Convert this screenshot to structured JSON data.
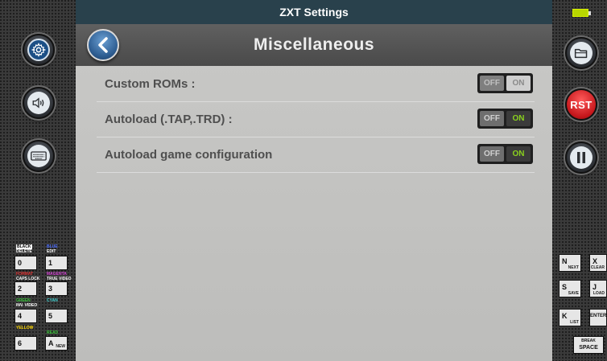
{
  "window": {
    "title": "ZXT Settings"
  },
  "header": {
    "title": "Miscellaneous"
  },
  "settings": [
    {
      "label": "Custom ROMs :",
      "off_label": "OFF",
      "on_label": "ON",
      "value": "off"
    },
    {
      "label": "Autoload (.TAP,.TRD) :",
      "off_label": "OFF",
      "on_label": "ON",
      "value": "on"
    },
    {
      "label": "Autoload game configuration",
      "off_label": "OFF",
      "on_label": "ON",
      "value": "on"
    }
  ],
  "left_panel": {
    "buttons": [
      {
        "icon": "gear-icon"
      },
      {
        "icon": "speaker-icon"
      },
      {
        "icon": "keyboard-icon"
      }
    ],
    "keys": [
      {
        "top": "BLACK",
        "top2": "DELETE",
        "key": "0",
        "bottom": ""
      },
      {
        "top": "BLUE",
        "top2": "EDIT",
        "key": "1",
        "bottom": ""
      },
      {
        "top": "FORMAT",
        "top2": "CAPS LOCK",
        "key": "2",
        "bottom": ""
      },
      {
        "top": "MAGENTA",
        "top2": "TRUE VIDEO",
        "key": "3",
        "bottom": ""
      },
      {
        "top": "GREEN",
        "top2": "INV. VIDEO",
        "key": "4",
        "bottom": ""
      },
      {
        "top": "CYAN",
        "top2": "",
        "key": "5",
        "bottom": ""
      },
      {
        "top": "YELLOW",
        "top2": "",
        "key": "6",
        "bottom": ""
      },
      {
        "top": "READ",
        "top2": "",
        "key": "A",
        "bottom": "NEW"
      }
    ]
  },
  "right_panel": {
    "battery": "battery-icon",
    "buttons": [
      {
        "icon": "folder-icon"
      },
      {
        "label": "RST"
      },
      {
        "icon": "pause-icon"
      }
    ],
    "keys": [
      {
        "key": "N",
        "sub": "NEXT"
      },
      {
        "key": "X",
        "sub": "CLEAR"
      },
      {
        "key": "S",
        "sub": "SAVE"
      },
      {
        "key": "J",
        "sub": "LOAD"
      },
      {
        "key": "K",
        "sub": "LIST"
      },
      {
        "key": "ENTER",
        "sub": ""
      },
      {
        "key": "BREAK",
        "sub": "SPACE"
      }
    ]
  }
}
